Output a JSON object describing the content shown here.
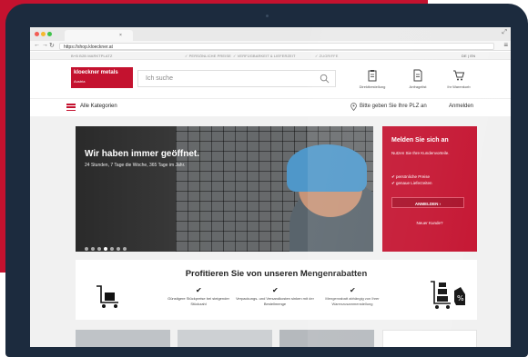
{
  "browser": {
    "url": "https://shop.kloeckner.at"
  },
  "strip": {
    "left": "B+B B2B MARKTPLATZ",
    "usp1": "✓ PERSÖNLICHE PREISE",
    "usp2": "✓ VERFÜGBARKEIT & LIEFERZEIT",
    "usp3": "✓ ZUGRIFFE",
    "lang": "DE | EN"
  },
  "header": {
    "logo_main": "kloeckner metals",
    "logo_sub": "Austria",
    "search_placeholder": "Ich suche",
    "actions": [
      {
        "label": "Direktbestellung"
      },
      {
        "label": "Anfragelist"
      },
      {
        "label": "Ihr Warenkorb"
      }
    ]
  },
  "nav": {
    "categories": "Alle Kategorien",
    "plz": "Bitte geben Sie Ihre PLZ an",
    "login": "Anmelden"
  },
  "hero": {
    "title": "Wir haben immer geöffnet.",
    "subtitle": "24 Stunden, 7 Tage die Woche, 365 Tage im Jahr."
  },
  "signin": {
    "title": "Melden Sie sich an",
    "desc": "Nutzen Sie Ihre Kundenvorteile.",
    "benefit1": "✔ persönliche Preise",
    "benefit2": "✔ genaue Lieferzeiten",
    "button": "ANMELDEN ›",
    "new_customer": "Neuer Kunde?"
  },
  "rabatt": {
    "title": "Profitieren Sie von unseren Mengenrabatten",
    "items": [
      {
        "text": "Günstigere Stückpreise bei steigender Stückzahl"
      },
      {
        "text": "Verpackungs- und Versandkosten sinken mit der Bestellmenge"
      },
      {
        "text": "Mengenrabatt abhängig von Ihrer Warenzusammenstellung"
      }
    ]
  },
  "colors": {
    "brand_red": "#c4122f",
    "laptop": "#1c2b3e"
  }
}
